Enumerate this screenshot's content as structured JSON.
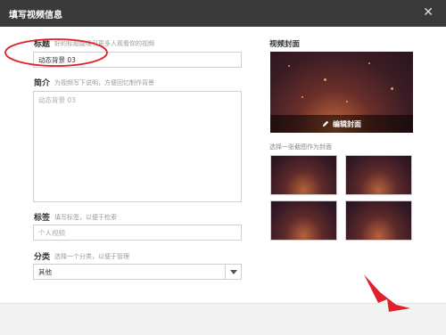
{
  "dialog": {
    "title": "填写视频信息",
    "close_icon": "close-icon"
  },
  "form": {
    "title_field": {
      "label": "标题",
      "hint": "好的标题能吸引更多人观看你的视频",
      "value": "动态背景 03"
    },
    "intro_field": {
      "label": "简介",
      "hint": "为视频写下说明，方便回忆制作背景",
      "placeholder": "动态背景 03"
    },
    "tags_field": {
      "label": "标签",
      "hint": "填写标签，以便于检索",
      "placeholder": "个人视频"
    },
    "category_field": {
      "label": "分类",
      "hint": "选择一个分类，以便于管理",
      "selected": "其他"
    }
  },
  "cover": {
    "title": "视频封面",
    "edit_label": "编辑封面",
    "thumbs_hint": "选择一张截图作为封面",
    "thumbnail_count": 4
  },
  "colors": {
    "titlebar": "#3a3a3a",
    "annotation": "#e0202c"
  }
}
